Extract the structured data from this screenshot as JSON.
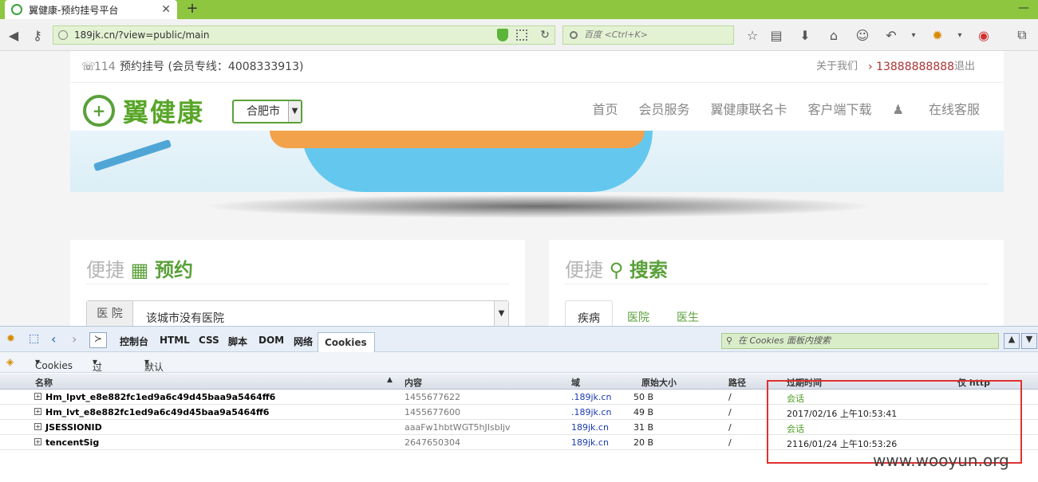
{
  "browser": {
    "tab_title": "翼健康-预约挂号平台",
    "new_tab_symbol": "+",
    "url": "189jk.cn/?view=public/main",
    "search_placeholder": "百度 <Ctrl+K>"
  },
  "site": {
    "hotline_prefix": "114",
    "hotline_text": "预约挂号 (会员专线：4008333913)",
    "about": "关于我们",
    "user_phone": "13888888888",
    "logout": "退出",
    "logo_text": "翼健康",
    "city": "合肥市",
    "nav": [
      "首页",
      "会员服务",
      "翼健康联名卡",
      "客户端下载",
      "在线客服"
    ],
    "booking_prefix": "便捷",
    "booking_title": "预约",
    "search_prefix": "便捷",
    "search_title": "搜索",
    "hospital_label": "医 院",
    "hospital_value": "该城市没有医院",
    "search_tabs": [
      "疾病",
      "医院",
      "医生"
    ]
  },
  "firebug": {
    "tabs": [
      "控制台",
      "HTML",
      "CSS",
      "脚本",
      "DOM",
      "网络"
    ],
    "active_tab": "Cookies",
    "search_placeholder": "在 Cookies 面板内搜索",
    "toolbar": [
      "Cookies",
      "过滤器",
      "默认 (接受第三方 cookie )"
    ],
    "columns": [
      "名称",
      "内容",
      "域",
      "原始大小",
      "路径",
      "过期时间",
      "仅 http"
    ],
    "rows": [
      {
        "name": "Hm_lpvt_e8e882fc1ed9a6c49d45baa9a5464ff6",
        "content": "1455677622",
        "domain": ".189jk.cn",
        "size": "50 B",
        "path": "/",
        "expires": "会话"
      },
      {
        "name": "Hm_lvt_e8e882fc1ed9a6c49d45baa9a5464ff6",
        "content": "1455677600",
        "domain": ".189jk.cn",
        "size": "49 B",
        "path": "/",
        "expires": "2017/02/16 上午10:53:41"
      },
      {
        "name": "JSESSIONID",
        "content": "aaaFw1hbtWGT5hJIsbIjv",
        "domain": "189jk.cn",
        "size": "31 B",
        "path": "/",
        "expires": "会话"
      },
      {
        "name": "tencentSig",
        "content": "2647650304",
        "domain": "189jk.cn",
        "size": "20 B",
        "path": "/",
        "expires": "2116/01/24 上午10:53:26"
      }
    ]
  },
  "watermark": "www.wooyun.org",
  "colors": {
    "brand_green": "#58a628",
    "browser_green": "#8ec63f",
    "highlight_red": "#e03030"
  }
}
